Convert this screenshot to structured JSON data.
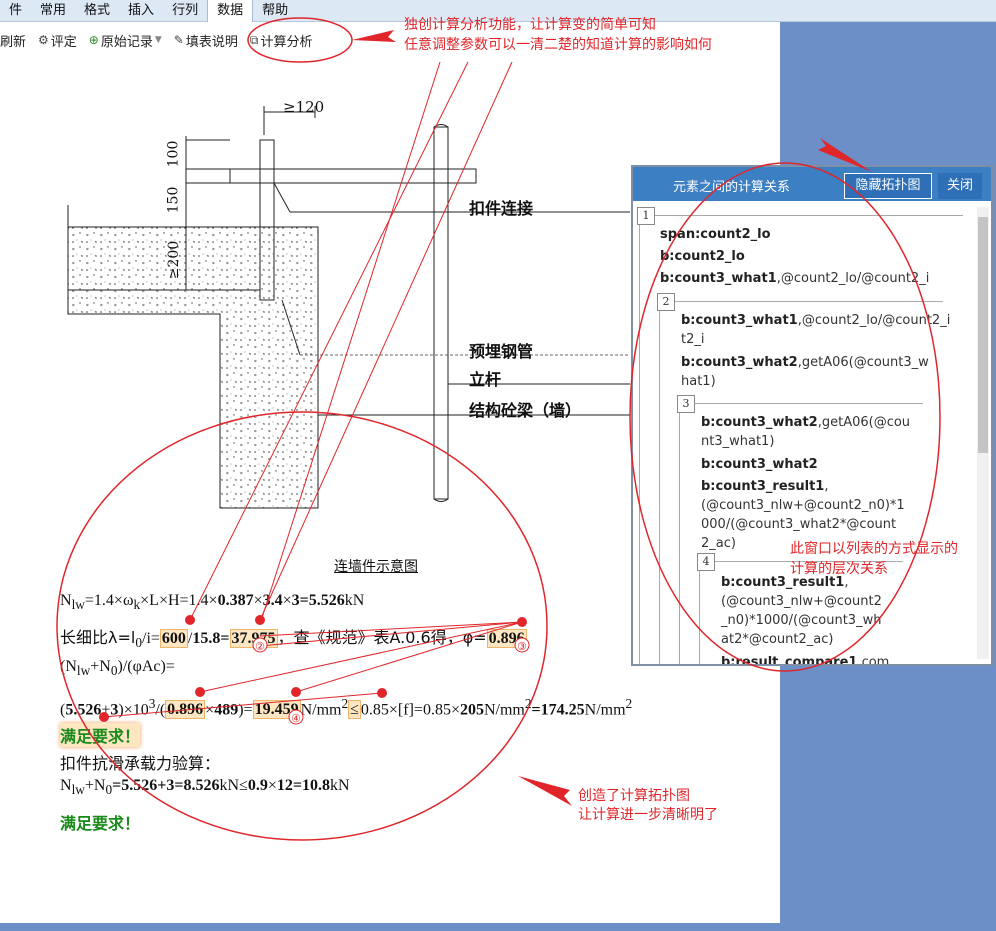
{
  "menu": {
    "items": [
      "件",
      "常用",
      "格式",
      "插入",
      "行列",
      "数据",
      "帮助"
    ],
    "active_index": 5
  },
  "toolbar": {
    "refresh": "刷新",
    "review": "评定",
    "original_record": "原始记录",
    "fill_note": "填表说明",
    "calc_analysis": "计算分析"
  },
  "drawing": {
    "dim_top": "≥120",
    "dim_100": "100",
    "dim_150": "150",
    "dim_200": "≥200",
    "label_connector": "扣件连接",
    "label_pipe": "预埋钢管",
    "label_pole": "立杆",
    "label_beam": "结构砼梁（墙）",
    "caption": "连墙件示意图"
  },
  "formulas": {
    "f1": {
      "a": "N",
      "a_sub": "lw",
      "b": "=1.4×ω",
      "b_sub": "k",
      "c": "×L×H=1.4×",
      "v1": "0.387",
      "m1": "×",
      "v2": "3.4",
      "m2": "×",
      "v3": "3",
      "eq": "=",
      "result": "5.526",
      "unit": "kN"
    },
    "f2": {
      "prefix": "长细比λ=l",
      "sub0": "0",
      "mid": "/i=",
      "v1": "600",
      "slash": "/",
      "v2": "15.8",
      "eq": "=",
      "v3": "37.975",
      "text": "，查《规范》表A.0.6得，φ=",
      "phi": "0.896"
    },
    "f3": {
      "a": "(N",
      "a_sub": "lw",
      "b": "+N",
      "b_sub": "0",
      "c": ")/(φAc)="
    },
    "f4": {
      "open": "(",
      "v1": "5.526",
      "plus": "+",
      "v2": "3",
      "close": ")×10",
      "exp": "3",
      "div": "/(",
      "v3": "0.896",
      "mul": "×",
      "v4": "489",
      "eq": ")=",
      "v5": "19.459",
      "unit": "N/mm",
      "unit_exp": "2",
      "le": "≤",
      "cmp": "0.85×[f]=0.85×",
      "v6": "205",
      "unit2": "N/mm",
      "unit2_exp": "2",
      "eq2": "=",
      "v7": "174.25",
      "unit3": "N/mm",
      "unit3_exp": "2"
    },
    "ok1": "满足要求！",
    "f5_label": "扣件抗滑承载力验算：",
    "f6": {
      "a": "N",
      "a_sub": "lw",
      "b": "+N",
      "b_sub": "0",
      "eq": "=",
      "v1": "5.526",
      "plus": "+",
      "v2": "3",
      "eq2": "=",
      "v3": "8.526",
      "unit": "kN≤",
      "v4": "0.9",
      "mul": "×",
      "v5": "12",
      "eq3": "=",
      "v6": "10.8",
      "unit2": "kN"
    },
    "ok2": "满足要求！"
  },
  "markers": [
    "②",
    "③",
    "④"
  ],
  "panel": {
    "title": "元素之间的计算关系",
    "hide_button": "隐藏拓扑图",
    "close_button": "关闭",
    "levels": [
      {
        "num": "1",
        "rows": [
          {
            "bold": "span:count2_lo",
            "rest": ""
          },
          {
            "bold": "b:count2_lo",
            "rest": ""
          },
          {
            "bold": "b:count3_what1",
            "rest": ",@count2_lo/@count2_i"
          }
        ]
      },
      {
        "num": "2",
        "rows": [
          {
            "bold": "b:count3_what1",
            "rest": ",@count2_lo/@count2_i",
            "line2": "t2_i"
          },
          {
            "bold": "b:count3_what2",
            "rest": ",getA06(@count3_w",
            "line2": "hat1)"
          }
        ]
      },
      {
        "num": "3",
        "rows": [
          {
            "bold": "b:count3_what2",
            "rest": ",getA06(@cou",
            "line2": "nt3_what1)"
          },
          {
            "bold": "b:count3_what2",
            "rest": ""
          },
          {
            "bold": "b:count3_result1",
            "rest": ",",
            "line2": "(@count3_nlw+@count2_n0)*1",
            "line3": "000/(@count3_what2*@count",
            "line4": "2_ac)"
          }
        ]
      },
      {
        "num": "4",
        "rows": [
          {
            "bold": "b:count3_result1",
            "rest": ",",
            "line2": "(@count3_nlw+@count2",
            "line3": "_n0)*1000/(@count3_wh",
            "line4": "at2*@count2_ac)"
          },
          {
            "bold": "b:result_compare1",
            "rest": ",com"
          }
        ]
      }
    ]
  },
  "annotations": {
    "top_note_1": "独创计算分析功能，让计算变的简单可知",
    "top_note_2": "任意调整参数可以一清二楚的知道计算的影响如何",
    "panel_note_1": "此窗口以列表的方式显示的",
    "panel_note_2": "计算的层次关系",
    "bottom_note_1": "创造了计算拓扑图",
    "bottom_note_2": "让计算进一步清晰明了"
  },
  "colors": {
    "menu_bg": "#dde8f5",
    "side_bg": "#6b8fc6",
    "panel_head": "#3d7fc3",
    "annotation": "#e0262a",
    "ok_green": "#1a8a1a"
  }
}
